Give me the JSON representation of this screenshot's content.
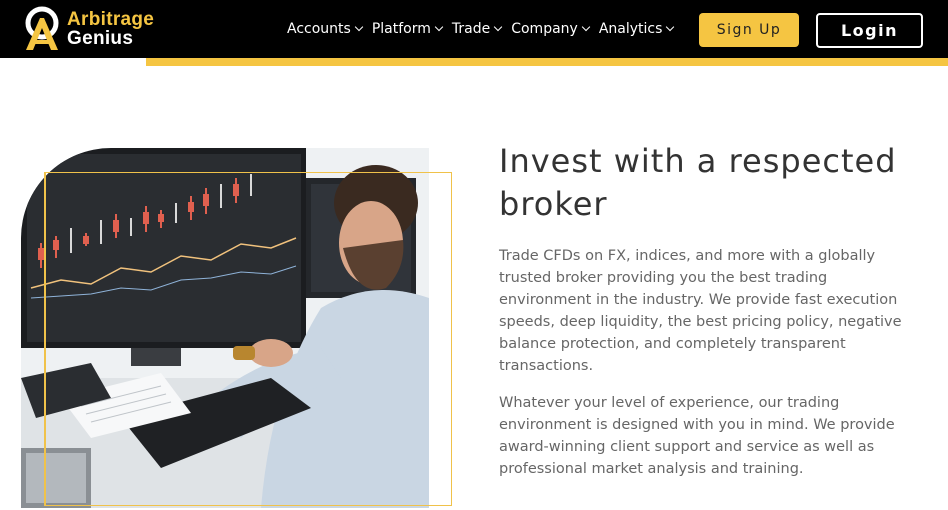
{
  "brand": {
    "line1": "Arbitrage",
    "line2": "Genius",
    "colors": {
      "accent": "#f5c542",
      "header_bg": "#000000"
    }
  },
  "nav": {
    "items": [
      {
        "label": "Accounts"
      },
      {
        "label": "Platform"
      },
      {
        "label": "Trade"
      },
      {
        "label": "Company"
      },
      {
        "label": "Analytics"
      }
    ],
    "signup_label": "Sign Up",
    "login_label": "Login"
  },
  "hero": {
    "title": "Invest with a respected broker",
    "paragraph1": "Trade CFDs on FX, indices, and more with a globally trusted broker providing you the best trading environment in the industry. We provide fast execution speeds, deep liquidity, the best pricing policy, negative balance protection, and completely transparent transactions.",
    "paragraph2": "Whatever your level of experience, our trading environment is designed with you in mind. We provide award-winning client support and service as well as professional market analysis and training."
  }
}
